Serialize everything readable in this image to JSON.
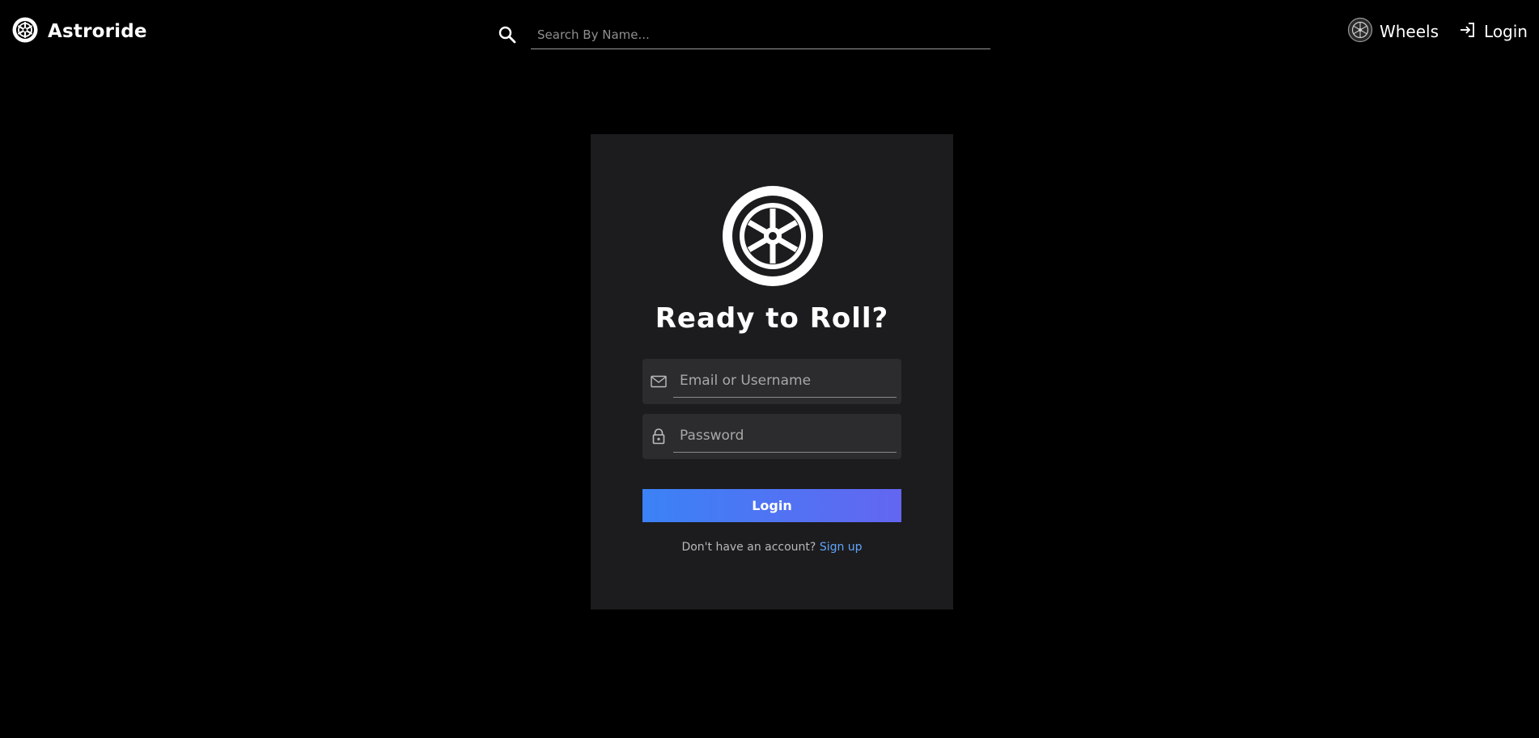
{
  "header": {
    "brand_name": "Astroride",
    "brand_icon": "wheel-icon",
    "search_placeholder": "Search By Name...",
    "search_icon": "search-icon",
    "nav": [
      {
        "label": "Wheels",
        "icon": "wheel-badge-icon"
      },
      {
        "label": "Login",
        "icon": "login-icon"
      }
    ]
  },
  "login_card": {
    "logo_icon": "wheel-icon",
    "title": "Ready to Roll?",
    "email_placeholder": "Email or Username",
    "password_placeholder": "Password",
    "login_button": "Login",
    "signup_prompt": "Don't have an account?",
    "signup_link": "Sign up"
  },
  "colors": {
    "background": "#000000",
    "card": "#1c1c1e",
    "field": "#2c2c2e",
    "accent_start": "#3b82f6",
    "accent_end": "#6366f1",
    "link": "#60a5fa"
  }
}
